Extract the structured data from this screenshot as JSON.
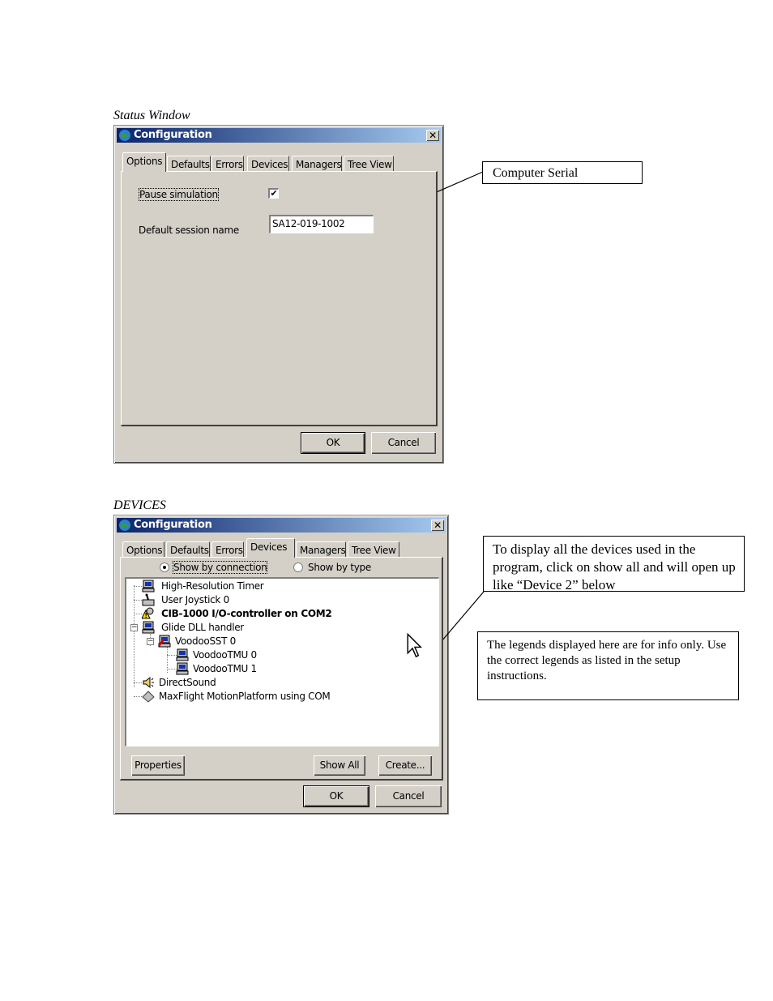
{
  "status_caption": "Status Window",
  "devices_caption": "DEVICES",
  "window1": {
    "title": "Configuration",
    "close": "✕",
    "tabs": [
      "Options",
      "Defaults",
      "Errors",
      "Devices",
      "Managers",
      "Tree View"
    ],
    "pause_label": "Pause simulation",
    "pause_checked": true,
    "check_mark": "✔",
    "session_label": "Default session name",
    "session_value": "SA12-019-1002",
    "ok": "OK",
    "cancel": "Cancel"
  },
  "window2": {
    "title": "Configuration",
    "close": "✕",
    "tabs": [
      "Options",
      "Defaults",
      "Errors",
      "Devices",
      "Managers",
      "Tree View"
    ],
    "radio_connection": "Show by connection",
    "radio_type": "Show by type",
    "tree": [
      {
        "label": "High-Resolution Timer",
        "icon": "computer-icon"
      },
      {
        "label": "User Joystick 0",
        "icon": "joystick-icon"
      },
      {
        "label": "CIB-1000 I/O-controller on COM2",
        "icon": "warning-device-icon"
      },
      {
        "label": "Glide DLL handler",
        "icon": "computer-icon"
      },
      {
        "label": "VoodooSST 0",
        "icon": "graphics-card-icon"
      },
      {
        "label": "VoodooTMU 0",
        "icon": "computer-icon"
      },
      {
        "label": "VoodooTMU 1",
        "icon": "computer-icon"
      },
      {
        "label": "DirectSound",
        "icon": "speaker-icon"
      },
      {
        "label": "MaxFlight MotionPlatform using COM",
        "icon": "diamond-icon"
      }
    ],
    "expander_minus": "−",
    "properties": "Properties",
    "show_all": "Show All",
    "create": "Create...",
    "ok": "OK",
    "cancel": "Cancel"
  },
  "callouts": {
    "serial": "Computer Serial",
    "show_all_note": "To display all the devices used in the program, click on show all and will open up like “Device 2” below",
    "legend_note": "The legends displayed here are for info only.  Use the correct legends as listed in the setup instructions."
  }
}
